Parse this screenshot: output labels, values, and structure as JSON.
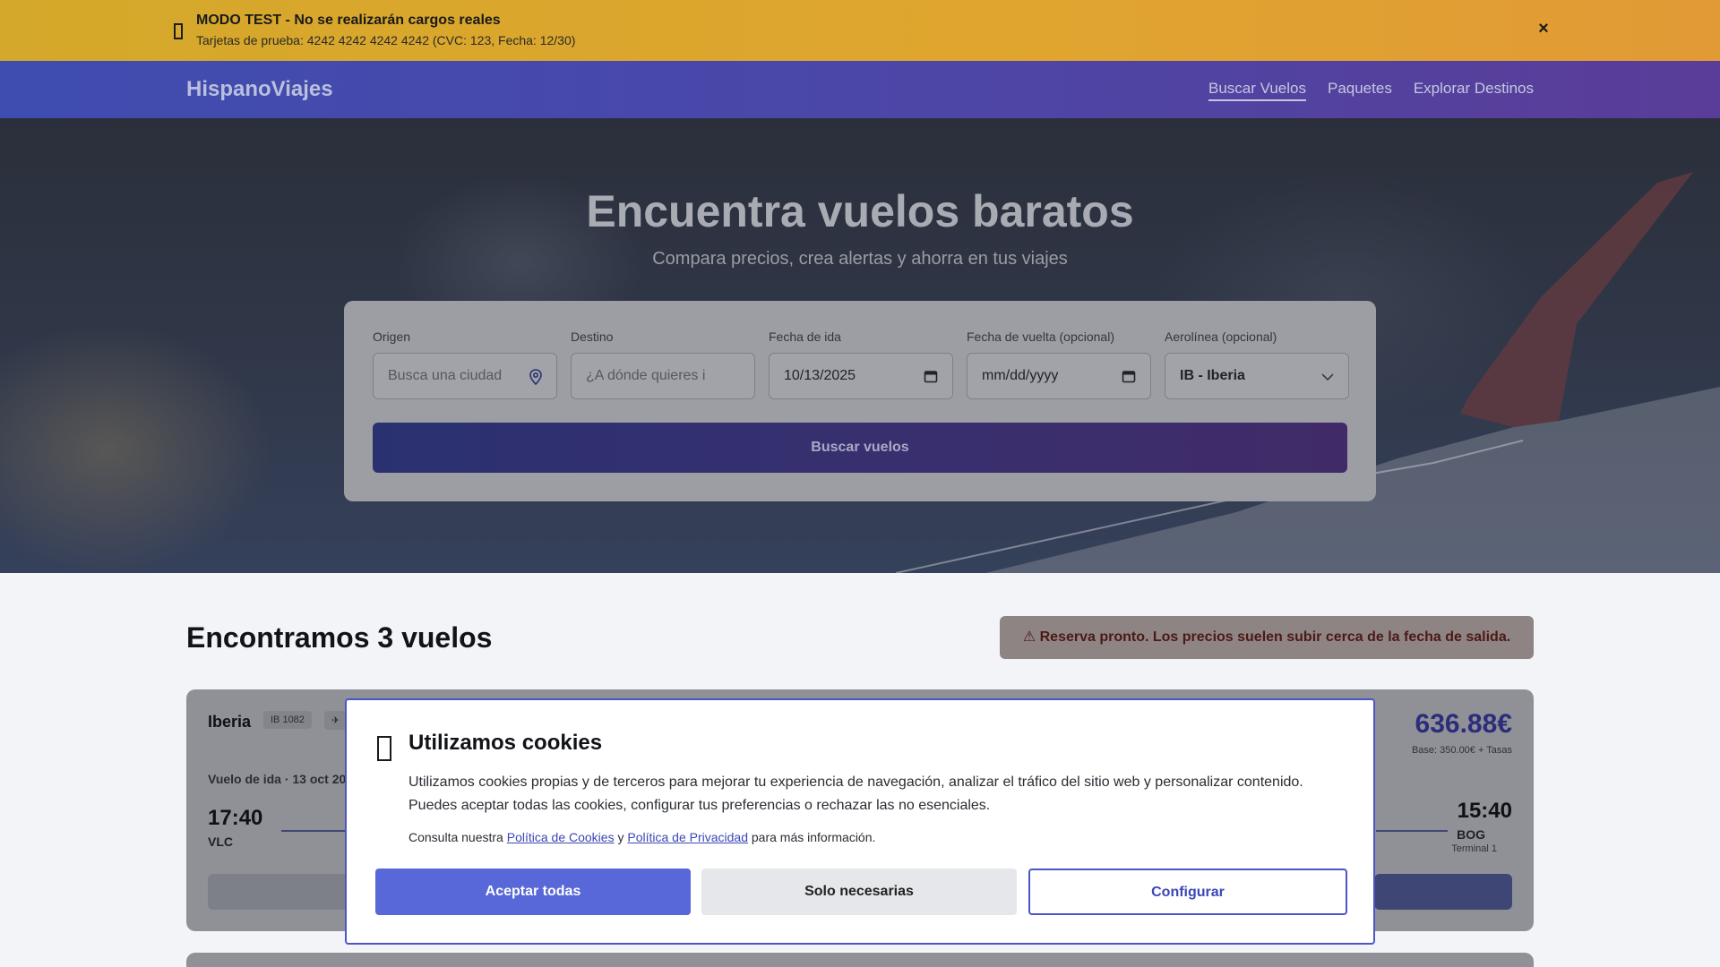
{
  "banner": {
    "title": "MODO TEST - No se realizarán cargos reales",
    "subtitle": "Tarjetas de prueba: 4242 4242 4242 4242 (CVC: 123, Fecha: 12/30)",
    "close": "×",
    "icon": "warning-icon"
  },
  "nav": {
    "brand": "HispanoViajes",
    "links": [
      "Buscar Vuelos",
      "Paquetes",
      "Explorar Destinos"
    ]
  },
  "hero": {
    "title": "Encuentra vuelos baratos",
    "subtitle": "Compara precios, crea alertas y ahorra en tus viajes"
  },
  "search": {
    "origin_label": "Origen",
    "origin_placeholder": "Busca una ciudad",
    "destination_label": "Destino",
    "destination_placeholder": "¿A dónde quieres i",
    "depart_label": "Fecha de ida",
    "depart_value": "10/13/2025",
    "return_label": "Fecha de vuelta (opcional)",
    "return_value": "mm/dd/yyyy",
    "airline_label": "Aerolínea (opcional)",
    "airline_value": "IB - Iberia",
    "submit": "Buscar vuelos"
  },
  "results": {
    "title": "Encontramos 3 vuelos",
    "alert": "⚠ Reserva pronto. Los precios suelen subir cerca de la fecha de salida.",
    "flights": [
      {
        "airline": "Iberia",
        "flight_code": "IB 1082",
        "chip": "✈",
        "price": "636.88€",
        "price_base": "Base: 350.00€ + Tasas",
        "leg": "Vuelo de ida · 13 oct 20",
        "dep_time": "17:40",
        "dep_iata": "VLC",
        "arr_time": "15:40",
        "arr_iata": "BOG",
        "arr_terminal": "Terminal 1"
      }
    ]
  },
  "cookies": {
    "title": "Utilizamos cookies",
    "description": "Utilizamos cookies propias y de terceros para mejorar tu experiencia de navegación, analizar el tráfico del sitio web y personalizar contenido. Puedes aceptar todas las cookies, configurar tus preferencias o rechazar las no esenciales.",
    "policy_prefix": "Consulta nuestra",
    "cookie_policy": "Política de Cookies",
    "and": "y",
    "privacy_policy": "Política de Privacidad",
    "policy_suffix": "para más información.",
    "accept": "Aceptar todas",
    "necessary": "Solo necesarias",
    "configure": "Configurar"
  }
}
